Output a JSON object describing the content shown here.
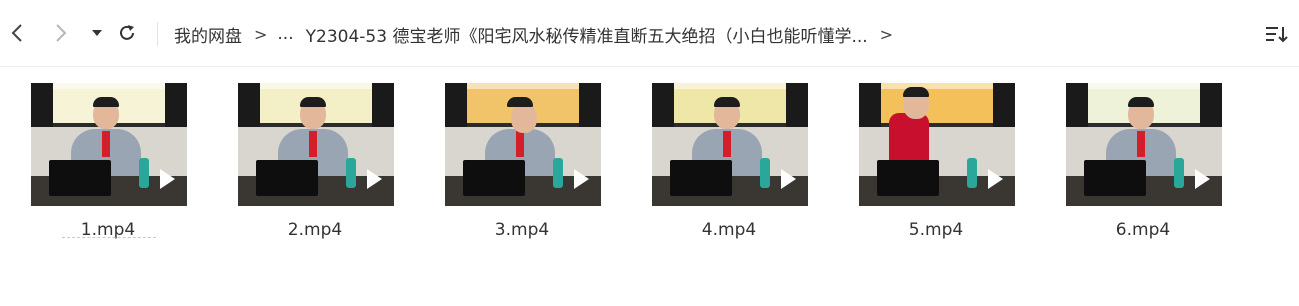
{
  "toolbar": {
    "back_icon": "chevron-left-icon",
    "forward_icon": "chevron-right-icon",
    "history_icon": "caret-down-icon",
    "refresh_icon": "refresh-icon",
    "sort_icon": "sort-list-icon"
  },
  "breadcrumb": {
    "root": "我的网盘",
    "ellipsis": "...",
    "current": "Y2304-53 德宝老师《阳宅风水秘传精准直断五大绝招（小白也能听懂学...",
    "separator": ">"
  },
  "files": [
    {
      "name": "1.mp4",
      "type": "video",
      "board_color": "#f7f3d6"
    },
    {
      "name": "2.mp4",
      "type": "video",
      "board_color": "#f3f0c8"
    },
    {
      "name": "3.mp4",
      "type": "video",
      "board_color": "#f1c46a"
    },
    {
      "name": "4.mp4",
      "type": "video",
      "board_color": "#efe7a8"
    },
    {
      "name": "5.mp4",
      "type": "video",
      "board_color": "#f4c05a"
    },
    {
      "name": "6.mp4",
      "type": "video",
      "board_color": "#eef2d8"
    }
  ],
  "colors": {
    "text": "#333333",
    "divider": "#eeeeee",
    "play": "#ffffff"
  }
}
